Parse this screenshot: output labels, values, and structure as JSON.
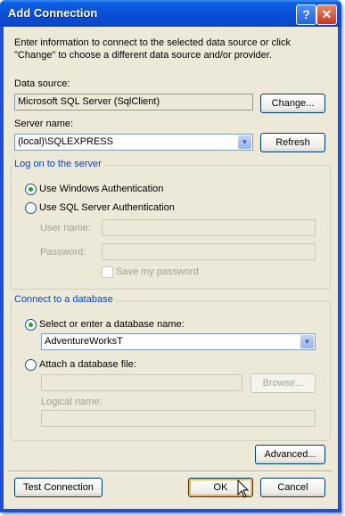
{
  "window": {
    "title": "Add Connection",
    "help_glyph": "?",
    "close_glyph": "✕"
  },
  "intro": {
    "line1": "Enter information to connect to the selected data source or click",
    "line2": "\"Change\" to choose a different data source and/or provider."
  },
  "data_source": {
    "label": "Data source:",
    "value": "Microsoft SQL Server (SqlClient)",
    "change_button": "Change..."
  },
  "server": {
    "label": "Server name:",
    "value": "(local)\\SQLEXPRESS",
    "refresh_button": "Refresh"
  },
  "logon": {
    "group_label": "Log on to the server",
    "windows_auth": "Use Windows Authentication",
    "sql_auth": "Use SQL Server Authentication",
    "user_label": "User name:",
    "user_value": "",
    "password_label": "Password:",
    "password_value": "",
    "save_password": "Save my password",
    "selected": "windows"
  },
  "database": {
    "group_label": "Connect to a database",
    "select_option": "Select or enter a database name:",
    "db_value": "AdventureWorksT",
    "attach_option": "Attach a database file:",
    "attach_value": "",
    "browse_button": "Browse...",
    "logical_label": "Logical name:",
    "logical_value": "",
    "selected": "select"
  },
  "buttons": {
    "advanced": "Advanced...",
    "test": "Test Connection",
    "ok": "OK",
    "cancel": "Cancel"
  },
  "icons": {
    "dropdown": "dropdown-arrow-icon",
    "cursor": "mouse-pointer-icon"
  },
  "colors": {
    "title_bar": "#0a4fd6",
    "group_label": "#0046d5",
    "selection": "#316ac5",
    "dialog_bg": "#ece9d8"
  }
}
